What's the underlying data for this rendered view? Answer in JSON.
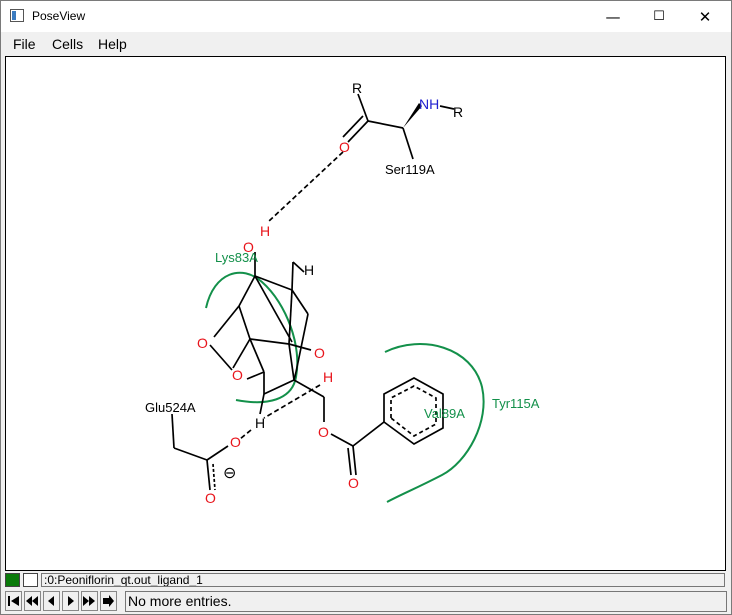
{
  "window": {
    "title": "PoseView",
    "minimize_glyph": "—",
    "maximize_glyph": "☐",
    "close_glyph": "✕"
  },
  "menu": {
    "items": [
      {
        "label": "File"
      },
      {
        "label": "Cells"
      },
      {
        "label": "Help"
      }
    ]
  },
  "diagram": {
    "atoms": {
      "r_top": "R",
      "nh": "NH",
      "r_right": "R",
      "o_carbonyl": "O",
      "h_hydroxyl_top": "H",
      "o_hydroxyl_top": "O",
      "h_bridge": "H",
      "o_ring_left": "O",
      "o_ring_bottom": "O",
      "o_hydroxyl_mid": "O",
      "h_hydroxyl_mid": "H",
      "h_lower": "H",
      "o_ester": "O",
      "o_ester_carbonyl": "O",
      "o_carboxylate": "O",
      "o_carboxylate_2": "O",
      "charge": "⊖"
    },
    "residues": {
      "ser": "Ser119A",
      "lys": "Lys83A",
      "glu": "Glu524A",
      "val": "Val89A",
      "tyr": "Tyr115A"
    },
    "colors": {
      "oxygen": "#e8141b",
      "nitrogen": "#2020d0",
      "hydrophobic": "#13904a",
      "bond": "#000000"
    }
  },
  "status": {
    "entry_label": ":0:Peoniflorin_qt.out_ligand_1",
    "message": "No more entries."
  },
  "nav": {
    "buttons": [
      "first-icon",
      "previous-page-icon",
      "previous-icon",
      "next-icon",
      "next-page-icon",
      "last-icon"
    ]
  }
}
